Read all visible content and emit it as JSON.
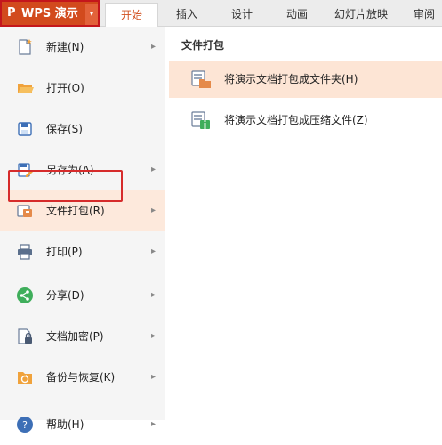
{
  "app": {
    "logo_glyph": "P",
    "title": "WPS 演示",
    "dropdown_glyph": "▾"
  },
  "tabs": [
    {
      "label": "开始",
      "active": true
    },
    {
      "label": "插入",
      "active": false
    },
    {
      "label": "设计",
      "active": false
    },
    {
      "label": "动画",
      "active": false
    },
    {
      "label": "幻灯片放映",
      "active": false
    },
    {
      "label": "审阅",
      "active": false
    }
  ],
  "menu": {
    "items": [
      {
        "label": "新建(N)",
        "icon": "new-file-icon",
        "submenu": true
      },
      {
        "label": "打开(O)",
        "icon": "open-folder-icon",
        "submenu": false
      },
      {
        "label": "保存(S)",
        "icon": "save-icon",
        "submenu": false
      },
      {
        "label": "另存为(A)",
        "icon": "save-as-icon",
        "submenu": true
      },
      {
        "label": "文件打包(R)",
        "icon": "package-icon",
        "submenu": true,
        "selected": true
      },
      {
        "label": "打印(P)",
        "icon": "print-icon",
        "submenu": true
      },
      {
        "label": "分享(D)",
        "icon": "share-icon",
        "submenu": true
      },
      {
        "label": "文档加密(P)",
        "icon": "encrypt-icon",
        "submenu": true
      },
      {
        "label": "备份与恢复(K)",
        "icon": "backup-icon",
        "submenu": true
      },
      {
        "label": "帮助(H)",
        "icon": "help-icon",
        "submenu": true
      }
    ],
    "chevron": "▸"
  },
  "panel": {
    "title": "文件打包",
    "options": [
      {
        "label": "将演示文档打包成文件夹(H)",
        "icon": "pack-to-folder-icon"
      },
      {
        "label": "将演示文档打包成压缩文件(Z)",
        "icon": "pack-to-zip-icon"
      }
    ]
  },
  "colors": {
    "accent": "#d2501f",
    "highlight_box": "#d62b2b",
    "selected_bg": "#fde9dc"
  }
}
